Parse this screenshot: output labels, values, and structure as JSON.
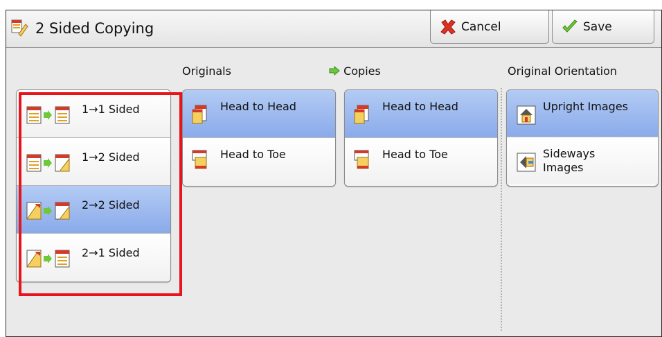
{
  "title": "2 Sided Copying",
  "header": {
    "cancel_label": "Cancel",
    "save_label": "Save"
  },
  "sided_options": [
    {
      "label": "1→1 Sided",
      "selected": false
    },
    {
      "label": "1→2 Sided",
      "selected": false
    },
    {
      "label": "2→2 Sided",
      "selected": true
    },
    {
      "label": "2→1 Sided",
      "selected": false
    }
  ],
  "originals": {
    "label": "Originals",
    "options": [
      {
        "label": "Head to Head",
        "selected": true
      },
      {
        "label": "Head to Toe",
        "selected": false
      }
    ]
  },
  "copies": {
    "label": "Copies",
    "options": [
      {
        "label": "Head to Head",
        "selected": true
      },
      {
        "label": "Head to Toe",
        "selected": false
      }
    ]
  },
  "orientation": {
    "label": "Original Orientation",
    "options": [
      {
        "label": "Upright Images",
        "selected": true
      },
      {
        "label": "Sideways Images",
        "selected": false
      }
    ]
  },
  "colors": {
    "selected": "#9bb8f0",
    "highlight": "#e8141c",
    "accent_green": "#5cbf2a"
  }
}
